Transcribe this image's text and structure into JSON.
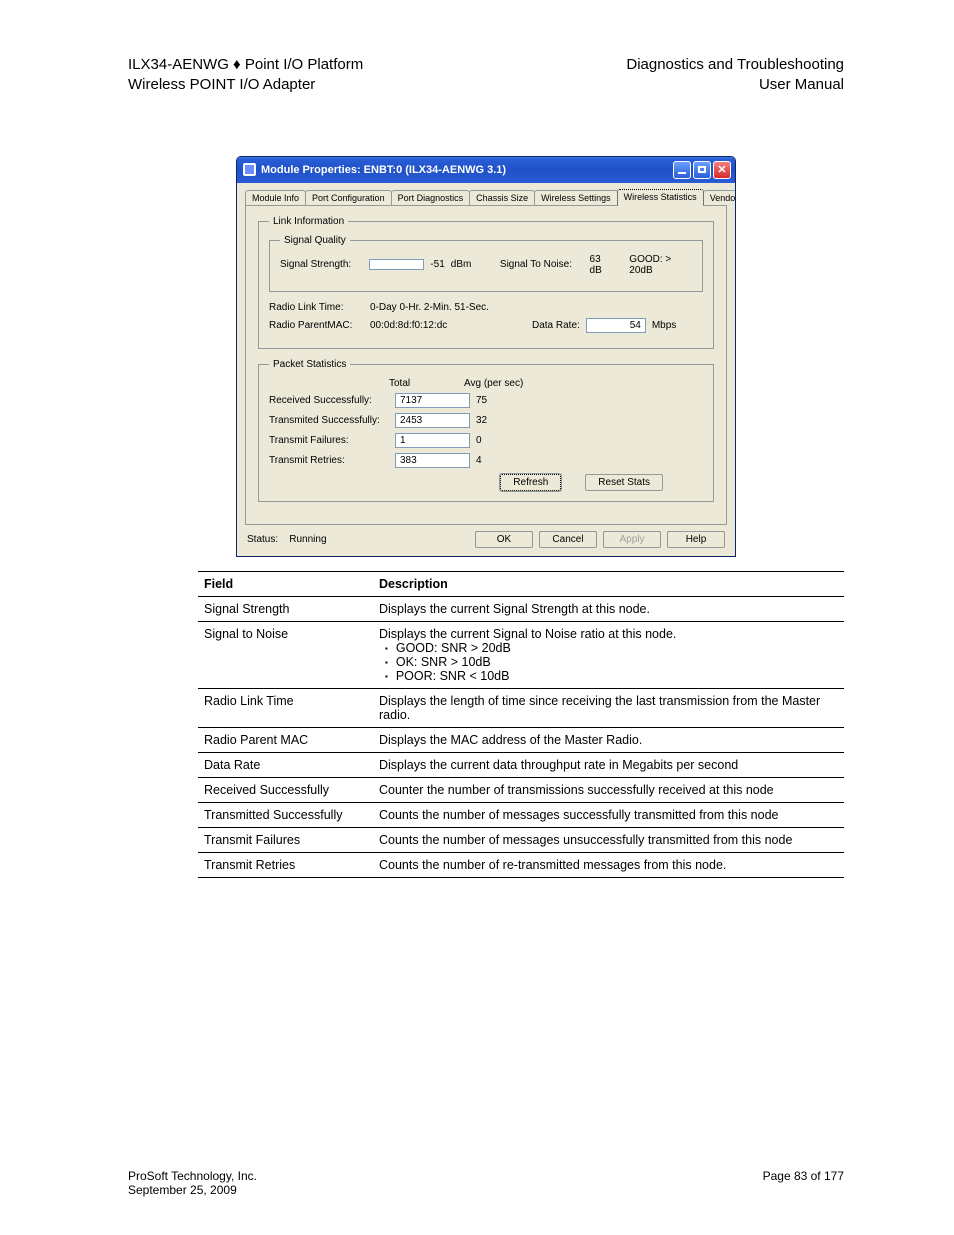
{
  "header": {
    "top_left_1": "ILX34-AENWG ♦ Point I/O Platform",
    "top_left_2": "Wireless POINT I/O Adapter",
    "top_right_1": "Diagnostics and Troubleshooting",
    "top_right_2": "User Manual"
  },
  "dialog": {
    "title": "Module Properties: ENBT:0 (ILX34-AENWG 3.1)",
    "tabs": {
      "t0": "Module Info",
      "t1": "Port Configuration",
      "t2": "Port Diagnostics",
      "t3": "Chassis Size",
      "t4": "Wireless Settings",
      "t5": "Wireless Statistics",
      "t6": "Vendor"
    },
    "link_info": {
      "legend": "Link Information",
      "signal_quality_legend": "Signal Quality",
      "signal_strength_label": "Signal Strength:",
      "signal_strength_value": "-51",
      "signal_strength_unit": "dBm",
      "signal_to_noise_label": "Signal To Noise:",
      "signal_to_noise_value": "63 dB",
      "signal_to_noise_rating": "GOOD: > 20dB",
      "radio_link_time_label": "Radio Link Time:",
      "radio_link_time_value": "0-Day 0-Hr. 2-Min. 51-Sec.",
      "radio_parent_mac_label": "Radio ParentMAC:",
      "radio_parent_mac_value": "00:0d:8d:f0:12:dc",
      "data_rate_label": "Data Rate:",
      "data_rate_value": "54",
      "data_rate_unit": "Mbps"
    },
    "packet": {
      "legend": "Packet Statistics",
      "total_label": "Total",
      "avg_label": "Avg (per sec)",
      "rows": {
        "r0": {
          "label": "Received Successfully:",
          "total": "7137",
          "avg": "75"
        },
        "r1": {
          "label": "Transmited Successfully:",
          "total": "2453",
          "avg": "32"
        },
        "r2": {
          "label": "Transmit Failures:",
          "total": "1",
          "avg": "0"
        },
        "r3": {
          "label": "Transmit Retries:",
          "total": "383",
          "avg": "4"
        }
      },
      "refresh": "Refresh",
      "reset": "Reset Stats"
    },
    "status_label": "Status:",
    "status_value": "Running",
    "ok": "OK",
    "cancel": "Cancel",
    "apply": "Apply",
    "help": "Help"
  },
  "table": {
    "head_field": "Field",
    "head_desc": "Description",
    "rows": {
      "r0": {
        "f": "Signal Strength",
        "d": "Displays the current Signal Strength at this node."
      },
      "r1": {
        "f": "Signal to Noise",
        "d_intro": "Displays the current Signal to Noise ratio at this node.",
        "b0": "GOOD: SNR > 20dB",
        "b1": "OK: SNR > 10dB",
        "b2": "POOR: SNR < 10dB"
      },
      "r2": {
        "f": "Radio Link Time",
        "d": "Displays the length of time since receiving the last transmission from the Master radio."
      },
      "r3": {
        "f": "Radio Parent MAC",
        "d": "Displays the MAC address of the Master Radio."
      },
      "r4": {
        "f": "Data Rate",
        "d": "Displays the current data throughput rate in Megabits per second"
      },
      "r5": {
        "f": "Received Successfully",
        "d": "Counter the number of transmissions successfully received at this node"
      },
      "r6": {
        "f": "Transmitted Successfully",
        "d": "Counts the number of messages successfully transmitted from this node"
      },
      "r7": {
        "f": "Transmit Failures",
        "d": "Counts the number of messages unsuccessfully transmitted from this node"
      },
      "r8": {
        "f": "Transmit Retries",
        "d": "Counts the number of re-transmitted messages from this node."
      }
    }
  },
  "footer": {
    "left": "ProSoft Technology, Inc.",
    "right": "Page 83 of 177",
    "date": "September 25, 2009"
  }
}
